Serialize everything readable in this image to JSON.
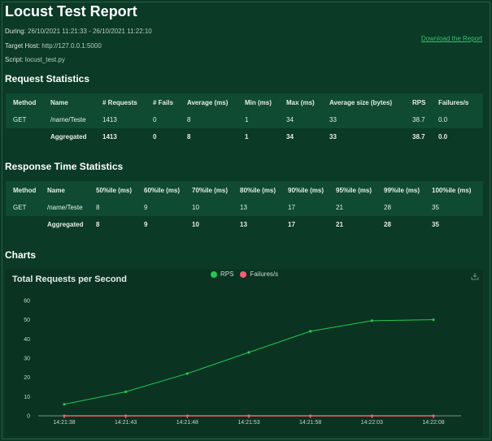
{
  "report": {
    "title": "Locust Test Report",
    "during_label": "During:",
    "during_value": "26/10/2021 11:21:33 - 26/10/2021 11:22:10",
    "host_label": "Target Host:",
    "host_value": "http://127.0.0.1:5000",
    "script_label": "Script:",
    "script_value": "locust_test.py",
    "download_label": "Download the Report"
  },
  "request_stats": {
    "heading": "Request Statistics",
    "columns": [
      "Method",
      "Name",
      "# Requests",
      "# Fails",
      "Average (ms)",
      "Min (ms)",
      "Max (ms)",
      "Average size (bytes)",
      "RPS",
      "Failures/s"
    ],
    "rows": [
      [
        "GET",
        "/name/Teste",
        "1413",
        "0",
        "8",
        "1",
        "34",
        "33",
        "38.7",
        "0.0"
      ],
      [
        "",
        "Aggregated",
        "1413",
        "0",
        "8",
        "1",
        "34",
        "33",
        "38.7",
        "0.0"
      ]
    ]
  },
  "response_stats": {
    "heading": "Response Time Statistics",
    "columns": [
      "Method",
      "Name",
      "50%ile (ms)",
      "60%ile (ms)",
      "70%ile (ms)",
      "80%ile (ms)",
      "90%ile (ms)",
      "95%ile (ms)",
      "99%ile (ms)",
      "100%ile (ms)"
    ],
    "rows": [
      [
        "GET",
        "/name/Teste",
        "8",
        "9",
        "10",
        "13",
        "17",
        "21",
        "28",
        "35"
      ],
      [
        "",
        "Aggregated",
        "8",
        "9",
        "10",
        "13",
        "17",
        "21",
        "28",
        "35"
      ]
    ]
  },
  "charts": {
    "heading": "Charts"
  },
  "colors": {
    "rps": "#22c94f",
    "failures": "#ff5c6e"
  },
  "chart_data": {
    "type": "line",
    "title": "Total Requests per Second",
    "x": [
      "14:21:38",
      "14:21:43",
      "14:21:48",
      "14:21:53",
      "14:21:58",
      "14:22:03",
      "14:22:08"
    ],
    "ylim": [
      0,
      60
    ],
    "yticks": [
      0,
      10,
      20,
      30,
      40,
      50,
      60
    ],
    "legend_position": "top-center",
    "series": [
      {
        "name": "RPS",
        "values": [
          6,
          12.5,
          22,
          33,
          44,
          49.5,
          50
        ]
      },
      {
        "name": "Failures/s",
        "values": [
          0,
          0,
          0,
          0,
          0,
          0,
          0
        ]
      }
    ]
  }
}
